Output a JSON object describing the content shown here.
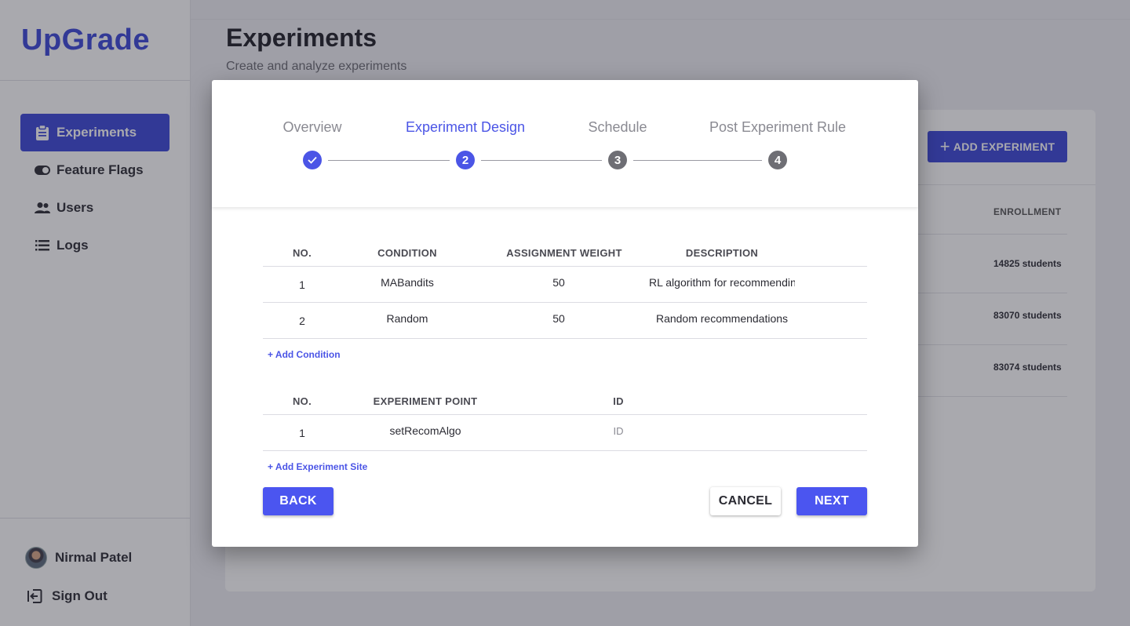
{
  "app": {
    "logo": "UpGrade"
  },
  "sidebar": {
    "items": [
      {
        "label": "Experiments",
        "icon": "clipboard-icon",
        "active": true
      },
      {
        "label": "Feature Flags",
        "icon": "toggle-icon",
        "active": false
      },
      {
        "label": "Users",
        "icon": "users-icon",
        "active": false
      },
      {
        "label": "Logs",
        "icon": "list-icon",
        "active": false
      }
    ],
    "user_name": "Nirmal Patel",
    "sign_out": "Sign Out"
  },
  "page": {
    "title": "Experiments",
    "subtitle": "Create and analyze experiments",
    "add_button": "ADD EXPERIMENT",
    "enrollment_header": "ENROLLMENT",
    "enrollment_values": [
      "14825 students",
      "83070 students",
      "83074 students"
    ]
  },
  "modal": {
    "steps": [
      {
        "label": "Overview",
        "marker": "",
        "state": "done"
      },
      {
        "label": "Experiment Design",
        "marker": "2",
        "state": "current"
      },
      {
        "label": "Schedule",
        "marker": "3",
        "state": "pending"
      },
      {
        "label": "Post Experiment Rule",
        "marker": "4",
        "state": "pending"
      }
    ],
    "conditions": {
      "headers": [
        "NO.",
        "CONDITION",
        "ASSIGNMENT WEIGHT",
        "DESCRIPTION"
      ],
      "rows": [
        {
          "no": "1",
          "condition": "MABandits",
          "weight": "50",
          "description": "RL algorithm for recommending"
        },
        {
          "no": "2",
          "condition": "Random",
          "weight": "50",
          "description": "Random recommendations"
        }
      ],
      "add_label": "+ Add Condition"
    },
    "points": {
      "headers": [
        "NO.",
        "EXPERIMENT POINT",
        "ID"
      ],
      "rows": [
        {
          "no": "1",
          "point": "setRecomAlgo",
          "id_placeholder": "ID"
        }
      ],
      "add_label": "+ Add Experiment Site"
    },
    "buttons": {
      "back": "BACK",
      "cancel": "CANCEL",
      "next": "NEXT"
    }
  },
  "colors": {
    "brand": "#3a45d8",
    "step_active": "#4b55e6",
    "step_pending": "#6e6e74"
  }
}
